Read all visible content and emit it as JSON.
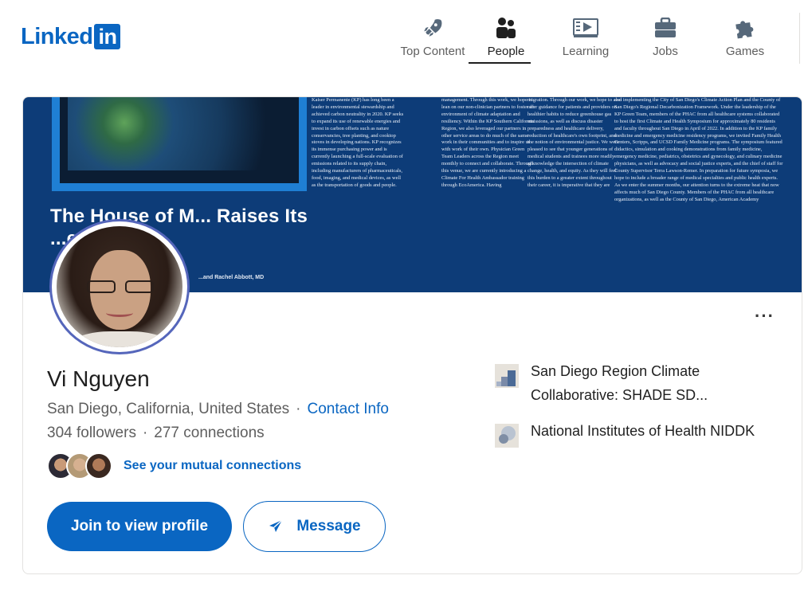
{
  "brand": {
    "logo_text": "Linked",
    "logo_box": "in",
    "brand_color": "#0a66c2"
  },
  "nav": {
    "items": [
      {
        "label": "Top Content",
        "icon": "rocket-icon",
        "active": false
      },
      {
        "label": "People",
        "icon": "people-icon",
        "active": true
      },
      {
        "label": "Learning",
        "icon": "video-play-icon",
        "active": false
      },
      {
        "label": "Jobs",
        "icon": "briefcase-icon",
        "active": false
      },
      {
        "label": "Games",
        "icon": "puzzle-icon",
        "active": false
      }
    ]
  },
  "banner": {
    "title": "The House of M... Raises Its ...e Planet",
    "byline": "...and Rachel Abbott, MD",
    "columns": [
      "Kaiser Permanente (KP) has long been a leader in environmental stewardship and achieved carbon neutrality in 2020. KP seeks to expand its use of renewable energies and invest in carbon offsets such as nature conservancies, tree planting, and cooktop stoves in developing nations. KP recognizes its immense purchasing power and is currently launching a full-scale evaluation of emissions related to its supply chain, including manufacturers of pharmaceuticals, food, imaging, and medical devices, as well as the transportation of goods and people.",
      "management. Through this work, we hope to lean on our non-clinician partners to foster an environment of climate adaptation and resiliency. Within the KP Southern California Region, we also leveraged our partners in other service areas to do much of the same work in their communities and to inspire us with work of their own. Physician Green Team Leaders across the Region meet monthly to connect and collaborate. Through this venue, we are currently introducing a Climate For Health Ambassador training through EcoAmerica. Having",
      "migration. Through our work, we hope to also offer guidance for patients and providers on healthier habits to reduce greenhouse gas emissions, as well as discuss disaster preparedness and healthcare delivery, reduction of healthcare's own footprint, and the notion of environmental justice. We were pleased to see that younger generations of medical students and trainees more readily acknowledge the intersection of climate change, health, and equity. As they will feel this burden to a greater extent throughout their career, it is imperative that they are",
      "and implementing the City of San Diego's Climate Action Plan and the County of San Diego's Regional Decarbonization Framework. Under the leadership of the KP Green Team, members of the PHAC from all healthcare systems collaborated to host the first Climate and Health Symposium for approximately 80 residents and faculty throughout San Diego in April of 2022. In addition to the KP family medicine and emergency medicine residency programs, we invited Family Health Centers, Scripps, and UCSD Family Medicine programs. The symposium featured didactics, simulation and cooking demonstrations from family medicine, emergency medicine, pediatrics, obstetrics and gynecology, and culinary medicine physicians, as well as advocacy and social justice experts, and the chief of staff for County Supervisor Terra Lawson-Remer. In preparation for future symposia, we hope to include a broader range of medical specialties and public health experts. As we enter the summer months, our attention turns to the extreme heat that now affects much of San Diego County. Members of the PHAC from all healthcare organizations, as well as the County of San Diego, American Academy"
    ]
  },
  "profile": {
    "name": "Vi Nguyen",
    "location": "San Diego, California, United States",
    "separator": "·",
    "contact_info": "Contact Info",
    "followers": "304 followers",
    "connections": "277 connections",
    "mutual_connections": "See your mutual connections",
    "more_icon": "more-horizontal-icon"
  },
  "actions": {
    "join_label": "Join to view profile",
    "message_label": "Message"
  },
  "organizations": [
    {
      "name": "San Diego Region Climate Collaborative: SHADE SD...",
      "icon": "sdrcc-logo"
    },
    {
      "name": "National Institutes of Health NIDDK",
      "icon": "nih-logo"
    }
  ]
}
